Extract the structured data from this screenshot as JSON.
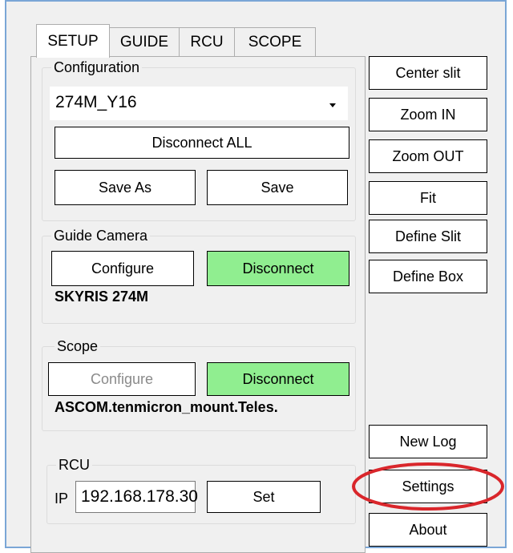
{
  "tabs": [
    {
      "label": "SETUP",
      "active": true
    },
    {
      "label": "GUIDE",
      "active": false
    },
    {
      "label": "RCU",
      "active": false
    },
    {
      "label": "SCOPE",
      "active": false
    }
  ],
  "configuration": {
    "title": "Configuration",
    "selected": "274M_Y16",
    "disconnect_all": "Disconnect ALL",
    "save_as": "Save As",
    "save": "Save"
  },
  "guide_camera": {
    "title": "Guide Camera",
    "configure": "Configure",
    "disconnect": "Disconnect",
    "device": "SKYRIS 274M"
  },
  "scope": {
    "title": "Scope",
    "configure": "Configure",
    "disconnect": "Disconnect",
    "device": "ASCOM.tenmicron_mount.Teles."
  },
  "rcu": {
    "title": "RCU",
    "ip_label": "IP",
    "ip_value": "192.168.178.30",
    "set": "Set"
  },
  "right_buttons": {
    "center_slit": "Center slit",
    "zoom_in": "Zoom IN",
    "zoom_out": "Zoom OUT",
    "fit": "Fit",
    "define_slit": "Define Slit",
    "define_box": "Define Box",
    "new_log": "New Log",
    "settings": "Settings",
    "about": "About"
  },
  "colors": {
    "accent_green": "#90ee90",
    "highlight_ellipse": "#d9262b",
    "window_border": "#7aa6d6"
  }
}
